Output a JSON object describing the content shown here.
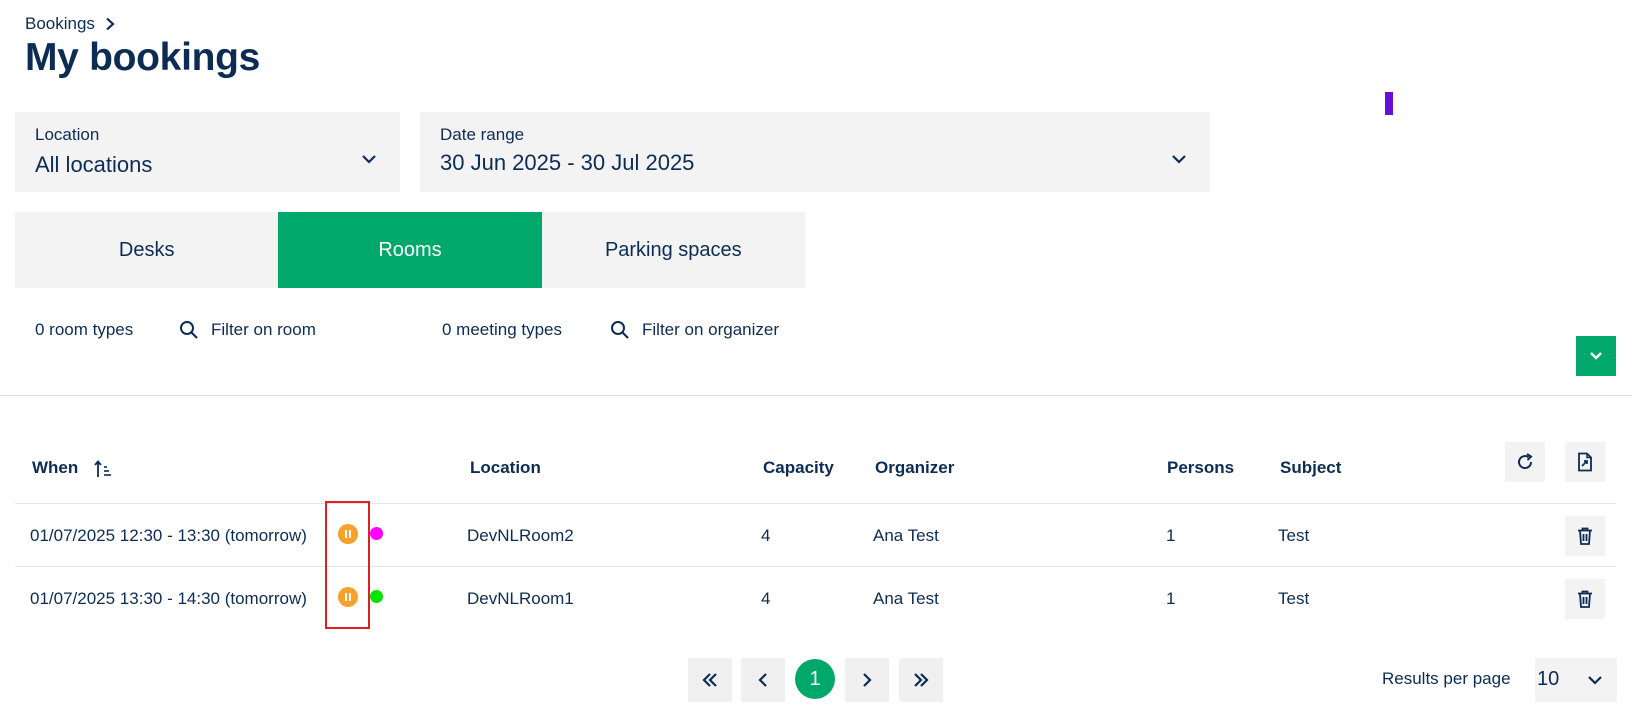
{
  "header": {
    "breadcrumb": "Bookings",
    "title": "My bookings"
  },
  "filters": {
    "location_label": "Location",
    "location_value": "All locations",
    "date_label": "Date range",
    "date_value": "30 Jun 2025 - 30 Jul 2025"
  },
  "tabs": [
    {
      "label": "Desks",
      "active": false
    },
    {
      "label": "Rooms",
      "active": true
    },
    {
      "label": "Parking spaces",
      "active": false
    }
  ],
  "subfilters": {
    "room_types": "0 room types",
    "filter_room": "Filter on room",
    "meeting_types": "0 meeting types",
    "filter_organizer": "Filter on organizer"
  },
  "table": {
    "headers": {
      "when": "When",
      "location": "Location",
      "capacity": "Capacity",
      "organizer": "Organizer",
      "persons": "Persons",
      "subject": "Subject"
    },
    "rows": [
      {
        "when": "01/07/2025 12:30 - 13:30 (tomorrow)",
        "location": "DevNLRoom2",
        "capacity": "4",
        "organizer": "Ana Test",
        "persons": "1",
        "subject": "Test",
        "dot_color": "#ff00ff",
        "status_icon": "pause-icon"
      },
      {
        "when": "01/07/2025 13:30 - 14:30 (tomorrow)",
        "location": "DevNLRoom1",
        "capacity": "4",
        "organizer": "Ana Test",
        "persons": "1",
        "subject": "Test",
        "dot_color": "#00e600",
        "status_icon": "pause-icon"
      }
    ]
  },
  "pagination": {
    "current_page": "1",
    "results_label": "Results per page",
    "per_page": "10"
  },
  "colors": {
    "accent": "#00a86b",
    "text": "#0d2c54",
    "status_pending": "#f7a12a",
    "highlight": "#e02020"
  }
}
